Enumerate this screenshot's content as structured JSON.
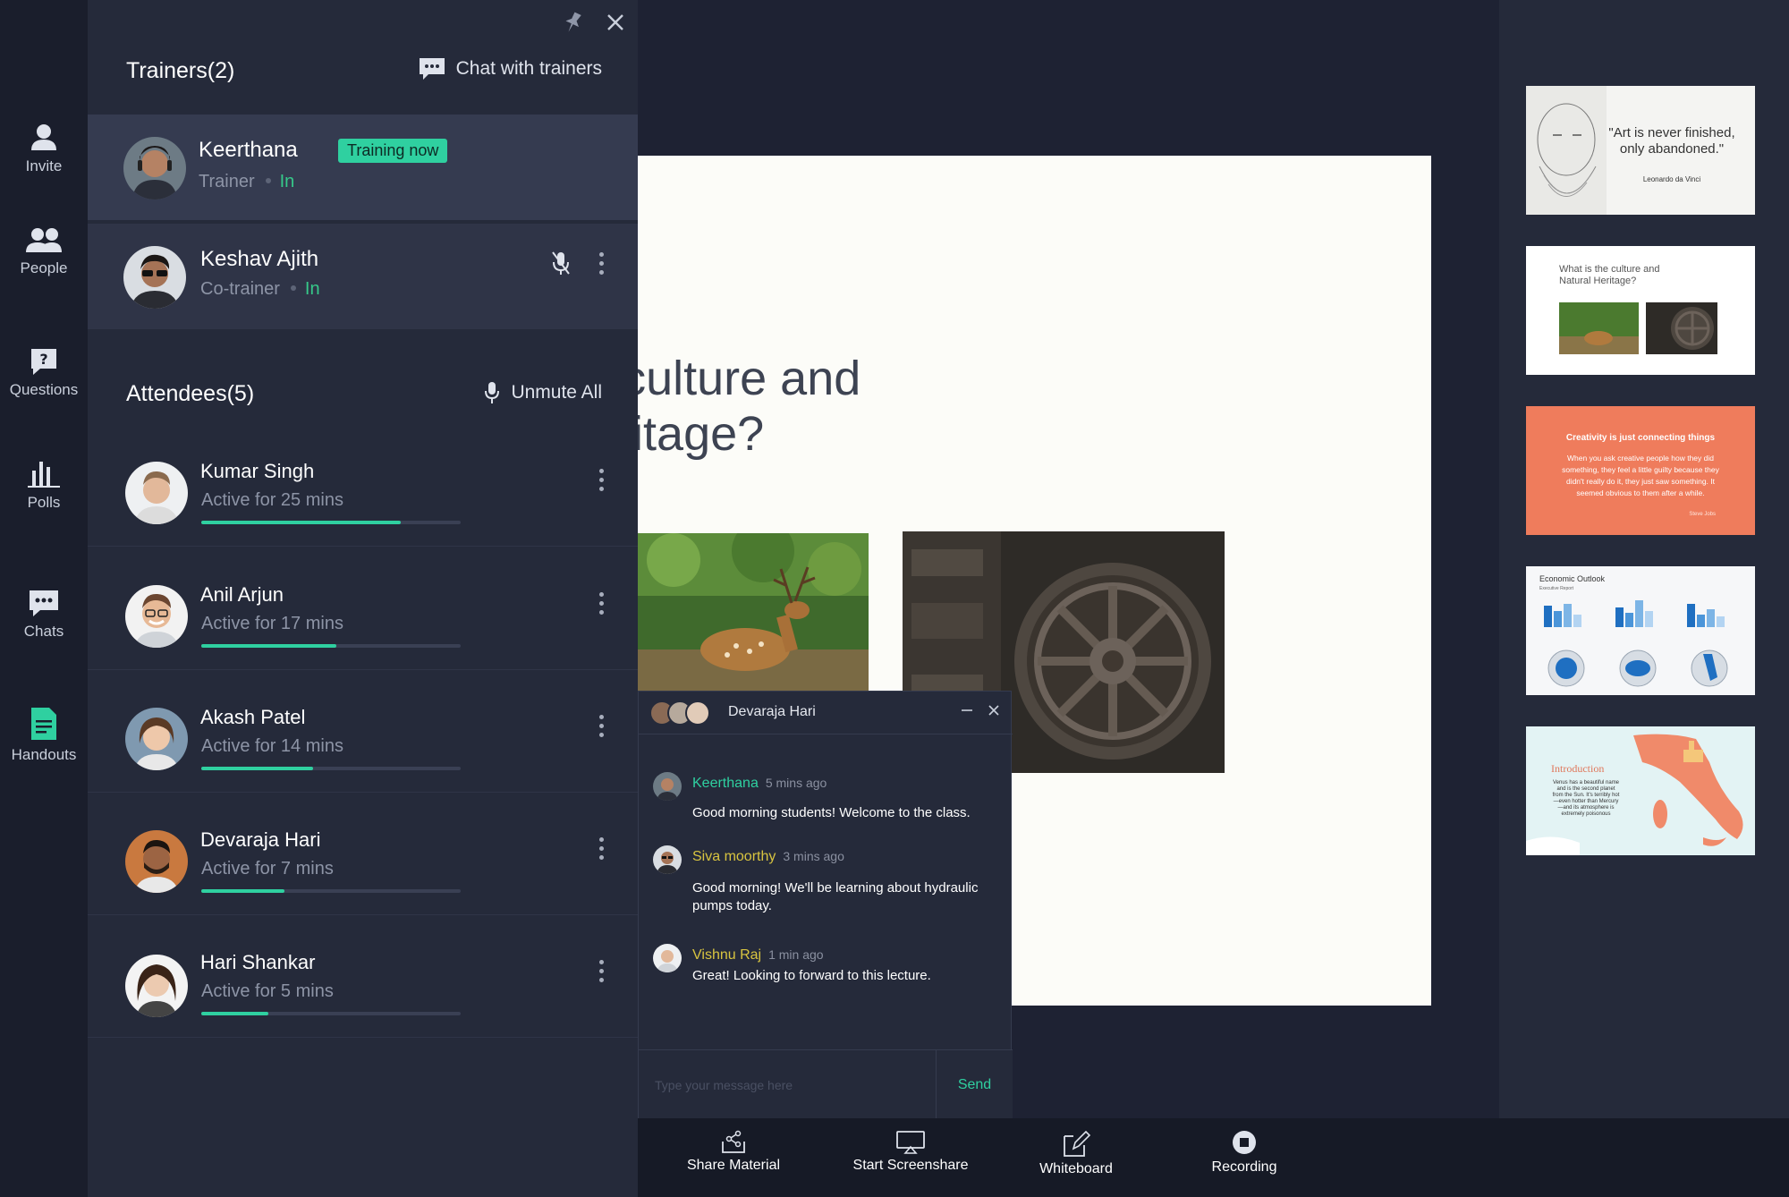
{
  "rail": {
    "items": [
      {
        "label": "Invite"
      },
      {
        "label": "People"
      },
      {
        "label": "Questions"
      },
      {
        "label": "Polls"
      },
      {
        "label": "Chats"
      },
      {
        "label": "Handouts"
      }
    ]
  },
  "trainers": {
    "title": "Trainers(2)",
    "action": "Chat with trainers",
    "people": [
      {
        "name": "Keerthana",
        "role": "Trainer",
        "status": "In",
        "badge": "Training now"
      },
      {
        "name": "Keshav Ajith",
        "role": "Co-trainer",
        "status": "In"
      }
    ]
  },
  "attendees": {
    "title": "Attendees(5)",
    "action": "Unmute All",
    "people": [
      {
        "name": "Kumar Singh",
        "activity": "Active for 25 mins",
        "progress": 0.77
      },
      {
        "name": "Anil Arjun",
        "activity": "Active for 17 mins",
        "progress": 0.52
      },
      {
        "name": "Akash Patel",
        "activity": "Active for 14 mins",
        "progress": 0.43
      },
      {
        "name": "Devaraja Hari",
        "activity": "Active for 7 mins",
        "progress": 0.32
      },
      {
        "name": "Hari Shankar",
        "activity": "Active for 5 mins",
        "progress": 0.26
      }
    ]
  },
  "slide": {
    "title": "s the culture and\nal Heritage?"
  },
  "chat": {
    "title": "Devaraja Hari",
    "messages": [
      {
        "author": "Keerthana",
        "time": "5 mins ago",
        "text": "Good morning students! Welcome to the class.",
        "color": "#2fd0a0"
      },
      {
        "author": "Siva moorthy",
        "time": "3 mins ago",
        "text": "Good morning! We'll be learning about hydraulic pumps today.",
        "color": "#d8c440"
      },
      {
        "author": "Vishnu Raj",
        "time": "1 min ago",
        "text": "Great! Looking to forward to this lecture.",
        "color": "#d8c440"
      }
    ],
    "input_placeholder": "Type your message here",
    "send_label": "Send"
  },
  "toolbar": {
    "share": "Share Material",
    "screenshare": "Start Screenshare",
    "whiteboard": "Whiteboard",
    "recording": "Recording"
  },
  "thumbnails": {
    "t1_quote": "\"Art is never finished, only abandoned.\"",
    "t1_author": "Leonardo da Vinci",
    "t2_question": "What is the culture and Natural Heritage?",
    "t3_heading": "Creativity is just connecting things",
    "t3_body": "When you ask creative people how they did something, they feel a little guilty because they didn't really do it, they just saw something. It seemed obvious to them after a while.",
    "t3_sig": "Steve Jobs",
    "t4_heading": "Economic Outlook",
    "t4_sub": "Executive Report",
    "t5_heading": "Introduction",
    "t5_body": "Venus has a beautiful name and is the second planet from the Sun. It's terribly hot—even hotter than Mercury—and its atmosphere is extremely poisonous"
  },
  "colors": {
    "accent": "#2fd0a0",
    "panel": "#252a3a",
    "rail": "#1a1e2c"
  }
}
